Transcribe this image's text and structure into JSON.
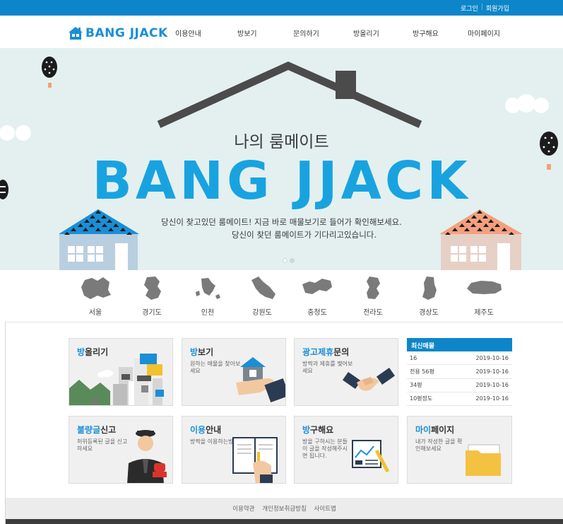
{
  "topbar": {
    "login": "로그인",
    "signup": "회원가입",
    "separator": "|"
  },
  "header": {
    "logo_text": "BANG JJACK",
    "nav": [
      "이용안내",
      "방보기",
      "문의하기",
      "방올리기",
      "방구해요",
      "마이페이지"
    ]
  },
  "hero": {
    "subtitle": "나의 룸메이트",
    "title": "BANG JJACK",
    "desc_line1": "당신이 찾고있던 룸메이트! 지금 바로 매물보기로 들어가 확인해보세요.",
    "desc_line2": "당신이 찾던 룸메이트가 기다리고있습니다.",
    "slide_count": 2,
    "active_slide": 2
  },
  "regions": [
    "서울",
    "경기도",
    "인천",
    "강원도",
    "충청도",
    "전라도",
    "경상도",
    "제주도"
  ],
  "cards": [
    {
      "hl": "방",
      "rest": "올리기",
      "desc": ""
    },
    {
      "hl": "방",
      "rest": "보기",
      "desc": "원하는 매물을 찾아보세요"
    },
    {
      "hl": "광고제휴",
      "rest": "문의",
      "desc": "방짝과 제휴를 맺어보세요"
    },
    {
      "hl": "불량글",
      "rest": "신고",
      "desc": "허위등록된 글을 신고하세요"
    },
    {
      "hl": "이용",
      "rest": "안내",
      "desc": "방짝을 이용하는방법!"
    },
    {
      "hl": "방",
      "rest": "구해요",
      "desc": "방을 구하시는 분들이 글을 작성해주시면 됩니다."
    },
    {
      "hl": "마이",
      "rest": "페이지",
      "desc": "내가 작성한 글을 확인해보세요"
    }
  ],
  "latest": {
    "title": "최신매물",
    "rows": [
      {
        "name": "16",
        "date": "2019-10-16"
      },
      {
        "name": "전용 56평",
        "date": "2019-10-16"
      },
      {
        "name": "34평",
        "date": "2019-10-16"
      },
      {
        "name": "10평정도",
        "date": "2019-10-16"
      }
    ]
  },
  "footer": {
    "links": [
      "이용약관",
      "개인정보취급방침",
      "사이트맵"
    ]
  },
  "colors": {
    "brand_blue": "#0d86c9",
    "logo_blue": "#1a8ed6",
    "hero_bg": "#e3f0ef"
  }
}
